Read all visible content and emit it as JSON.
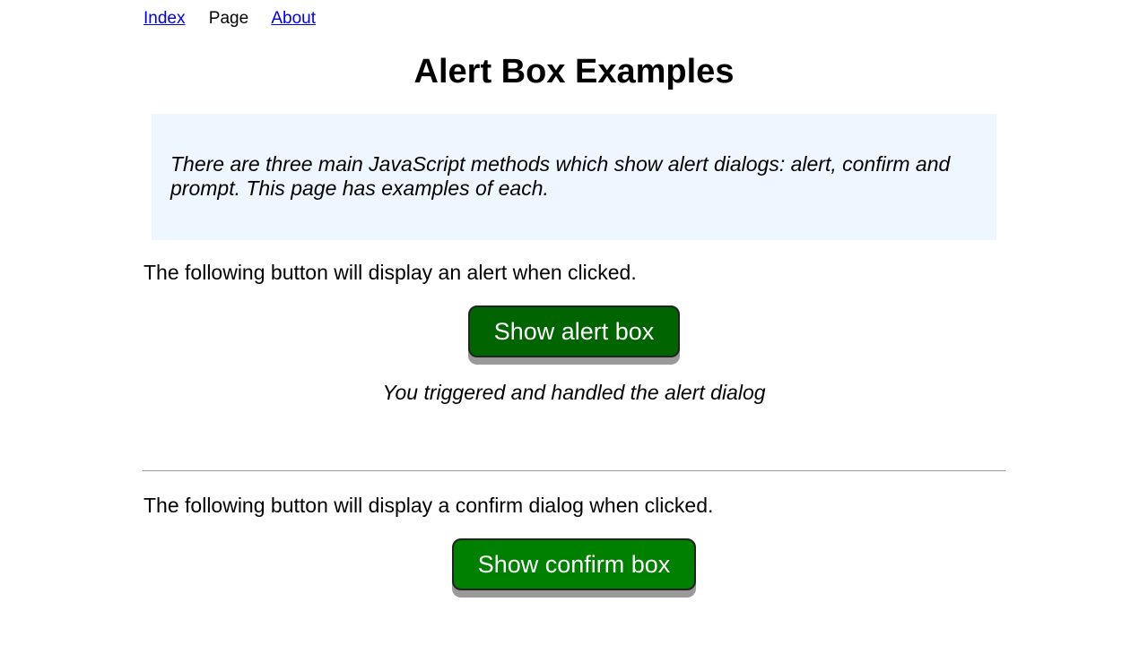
{
  "nav": {
    "index_label": "Index",
    "page_label": "Page",
    "about_label": "About"
  },
  "page_title": "Alert Box Examples",
  "intro_text": "There are three main JavaScript methods which show alert dialogs: alert, confirm and prompt. This page has examples of each.",
  "alert_section": {
    "description": "The following button will display an alert when clicked.",
    "button_label": "Show alert box",
    "result_text": "You triggered and handled the alert dialog"
  },
  "confirm_section": {
    "description": "The following button will display a confirm dialog when clicked.",
    "button_label": "Show confirm box"
  },
  "colors": {
    "link": "#0000ee",
    "intro_background": "#eef7ff",
    "alert_button": "#006400",
    "confirm_button": "#008000"
  }
}
